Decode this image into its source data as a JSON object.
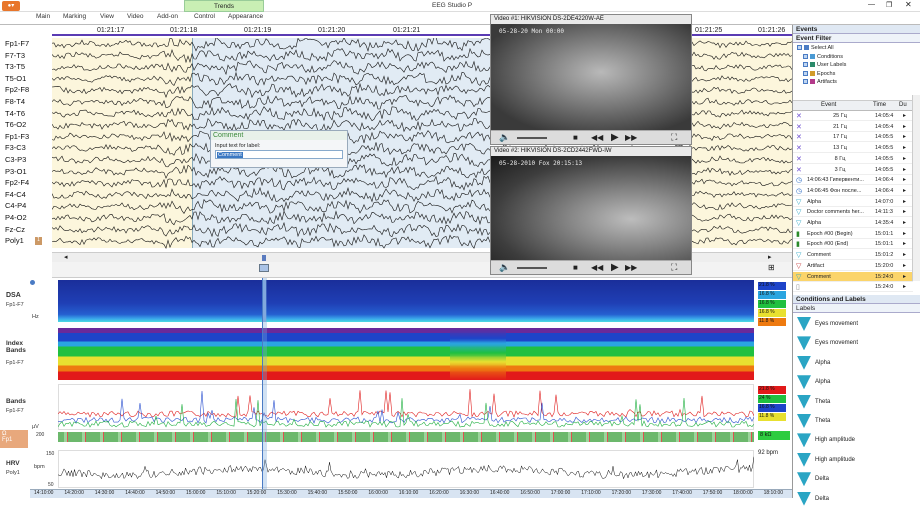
{
  "app": {
    "title": "EEG Studio P"
  },
  "ribbon": {
    "trends_label": "Trends",
    "tabs": [
      "Main",
      "Marking",
      "View",
      "Video",
      "Add-on",
      "Control",
      "Appearance"
    ]
  },
  "eeg": {
    "channels": [
      "Fp1-F7",
      "F7-T3",
      "T3-T5",
      "T5-O1",
      "Fp2-F8",
      "F8-T4",
      "T4-T6",
      "T6-O2",
      "Fp1-F3",
      "F3-C3",
      "C3-P3",
      "P3-O1",
      "Fp2-F4",
      "F4-C4",
      "C4-P4",
      "P4-O2",
      "Fz-Cz",
      "Poly1"
    ],
    "times": [
      "01:21:17",
      "01:21:18",
      "01:21:19",
      "01:21:20",
      "01:21:21",
      "01:21:25",
      "01:21:26"
    ],
    "comment_dialog": {
      "title": "Comment",
      "prompt": "Input text for label:",
      "value": "Comment"
    }
  },
  "videos": [
    {
      "title": "Video #1: HIKVISION DS-2DE4220W-AE",
      "overlay": "05-28-20  Mon 00:00"
    },
    {
      "title": "Video #2: HIKVISION DS-2CD2442FWD-IW",
      "overlay": "05-28-2010 Fox 20:15:13"
    }
  ],
  "panes": {
    "dsa": {
      "title": "DSA",
      "sub": "Fp1-F7",
      "unit": "Hz"
    },
    "index": {
      "title": "Index Bands",
      "sub": "Fp1-F7",
      "values": [
        "21.8 %",
        "16.8 %",
        "16.8 %",
        "16.8 %",
        "11.8 %"
      ]
    },
    "bands": {
      "title": "Bands",
      "sub": "Fp1-F7",
      "unit": "µV",
      "values": [
        "21.8 %",
        "24 %",
        "16.8 %",
        "11.8 %"
      ]
    },
    "d_label": {
      "title": "Ω",
      "sub": "Fp1",
      "scale": "200",
      "status": "8 kΩ"
    },
    "hrv": {
      "title": "HRV",
      "sub": "Poly1",
      "unit": "bpm",
      "value": "92 bpm",
      "scale": [
        "150",
        "50"
      ]
    },
    "timeline": [
      "14:10:00",
      "14:20:00",
      "14:30:00",
      "14:40:00",
      "14:50:00",
      "15:00:00",
      "15:10:00",
      "15:20:00",
      "15:30:00",
      "15:40:00",
      "15:50:00",
      "16:00:00",
      "16:10:00",
      "16:20:00",
      "16:30:00",
      "16:40:00",
      "16:50:00",
      "17:00:00",
      "17:10:00",
      "17:20:00",
      "17:30:00",
      "17:40:00",
      "17:50:00",
      "18:00:00",
      "18:10:00"
    ]
  },
  "events_panel": {
    "title": "Events",
    "filter_title": "Event Filter",
    "filters": [
      "Select All",
      "Conditions",
      "User Labels",
      "Epochs",
      "Artifacts"
    ],
    "columns": [
      "Event",
      "Time",
      "Du"
    ],
    "rows": [
      {
        "event": "25 Гц",
        "time": "14:05:4"
      },
      {
        "event": "21 Гц",
        "time": "14:05:4"
      },
      {
        "event": "17 Гц",
        "time": "14:05:5"
      },
      {
        "event": "13 Гц",
        "time": "14:05:5"
      },
      {
        "event": "8 Гц",
        "time": "14:05:5"
      },
      {
        "event": "3 Гц",
        "time": "14:05:5"
      },
      {
        "event": "14:06:43 Гипервенти...",
        "time": "14:06:4"
      },
      {
        "event": "14:06:45 Фон после...",
        "time": "14:06:4"
      },
      {
        "event": "Alpha",
        "time": "14:07:0"
      },
      {
        "event": "Doctor comments her...",
        "time": "14:11:3"
      },
      {
        "event": "Alpha",
        "time": "14:35:4"
      },
      {
        "event": "Epoch #00 (Begin)",
        "time": "15:01:1"
      },
      {
        "event": "Epoch #00 (End)",
        "time": "15:01:1"
      },
      {
        "event": "Comment",
        "time": "15:01:2"
      },
      {
        "event": "Artifact",
        "time": "15:20:0"
      },
      {
        "event": "Comment",
        "time": "15:24:0"
      },
      {
        "event": "",
        "time": "15:24:0"
      }
    ]
  },
  "conditions_panel": {
    "title": "Conditions and Labels",
    "sub": "Labels",
    "items": [
      "Eyes movement",
      "Eyes movement",
      "Alpha",
      "Alpha",
      "Theta",
      "Theta",
      "High amplitude",
      "High amplitude",
      "Delta",
      "Delta"
    ]
  },
  "colors": {
    "accent": "#3a78c3",
    "event_highlight": "#fbd46a",
    "ribbon_trends": "#c9efb4"
  }
}
